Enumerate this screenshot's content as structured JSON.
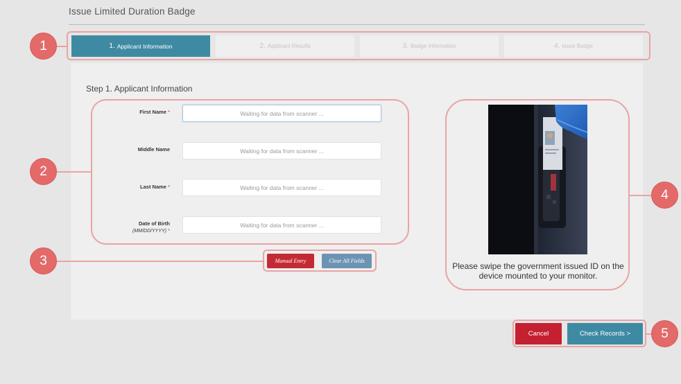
{
  "page": {
    "title": "Issue Limited Duration Badge"
  },
  "steps": [
    {
      "number": "1.",
      "label": "Applicant Information"
    },
    {
      "number": "2.",
      "label": "Applicant Results"
    },
    {
      "number": "3.",
      "label": "Badge Information"
    },
    {
      "number": "4.",
      "label": "Issue Badge"
    }
  ],
  "form": {
    "heading": "Step 1. Applicant Information",
    "first_name": {
      "label": "First Name",
      "required": "*",
      "placeholder": "Waiting for data from scanner ..."
    },
    "middle_name": {
      "label": "Middle Name",
      "placeholder": "Waiting for data from scanner ..."
    },
    "last_name": {
      "label": "Last Name",
      "required": "*",
      "placeholder": "Waiting for data from scanner ..."
    },
    "dob": {
      "label": "Date of Birth",
      "format": "(MM/DD/YYYY)",
      "required": "*",
      "placeholder": "Waiting for data from scanner ..."
    }
  },
  "buttons": {
    "manual_entry": "Manual Entry",
    "clear_all": "Clear All Fields",
    "cancel": "Cancel",
    "check_records": "Check Records >"
  },
  "scanner": {
    "instruction": "Please swipe the government issued ID on the device mounted to your monitor."
  },
  "callouts": [
    "1",
    "2",
    "3",
    "4",
    "5"
  ],
  "colors": {
    "primary": "#3f8aa3",
    "danger": "#c42030",
    "secondary": "#6d93b4",
    "callout": "#e46a6a",
    "callout_outline": "#eaa3a3"
  }
}
